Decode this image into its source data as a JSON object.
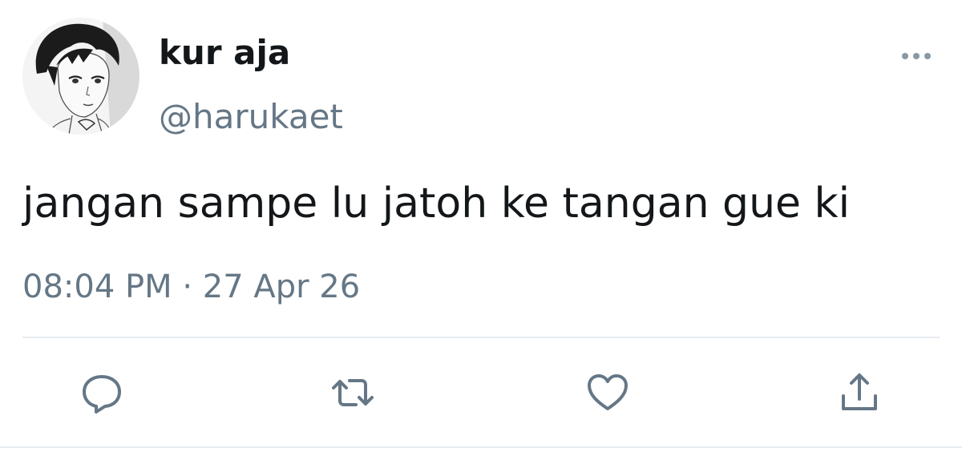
{
  "user": {
    "display_name": "kur aja",
    "handle": "@harukaet"
  },
  "tweet": {
    "text": "jangan sampe lu jatoh ke tangan gue ki",
    "timestamp": "08:04 PM · 27 Apr 26"
  },
  "actions": {
    "reply_icon": "reply-icon",
    "retweet_icon": "retweet-icon",
    "like_icon": "heart-icon",
    "share_icon": "share-icon"
  },
  "colors": {
    "text_primary": "#14171a",
    "text_secondary": "#657786",
    "icon": "#657786",
    "divider": "#e6ecf0"
  }
}
